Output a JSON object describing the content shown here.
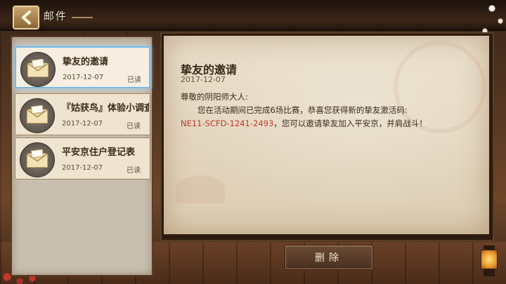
{
  "header": {
    "title": "邮件",
    "back_icon": "chevron-left-icon"
  },
  "mail_list": [
    {
      "title": "挚友的邀请",
      "date": "2017-12-07",
      "status": "已读",
      "icon": "envelope-icon",
      "selected": true
    },
    {
      "title": "『姑获鸟』体验小调查",
      "date": "2017-12-07",
      "status": "已读",
      "icon": "envelope-icon",
      "selected": false
    },
    {
      "title": "平安京住户登记表",
      "date": "2017-12-07",
      "status": "已读",
      "icon": "envelope-icon",
      "selected": false
    }
  ],
  "letter": {
    "title": "挚友的邀请",
    "date": "2017-12-07",
    "greeting": "尊敬的阴阳师大人:",
    "body_part1": "您在活动期间已完成6场比赛，恭喜您获得新的挚友激活码:",
    "code": "NE11-SCFD-1241-2493",
    "body_part2": "，您可以邀请挚友加入平安京，并肩战斗！"
  },
  "actions": {
    "delete_label": "删除"
  },
  "colors": {
    "accent_selected": "#79b9e6",
    "code_red": "#c0392b",
    "paper": "#eadfcb",
    "wood": "#5b3a24"
  }
}
